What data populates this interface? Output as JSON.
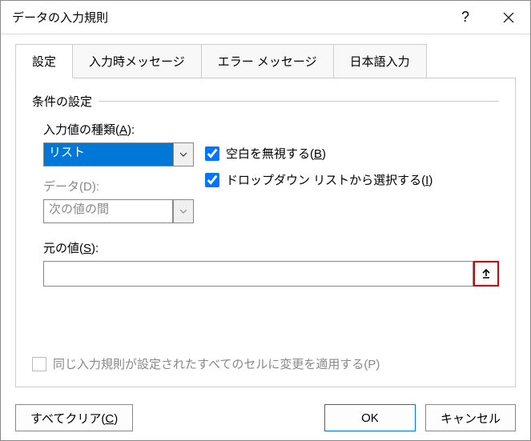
{
  "titlebar": {
    "title": "データの入力規則"
  },
  "tabs": {
    "settings": "設定",
    "input_msg": "入力時メッセージ",
    "error_msg": "エラー メッセージ",
    "ime": "日本語入力"
  },
  "fieldset": {
    "legend": "条件の設定"
  },
  "allow": {
    "label_pre": "入力値の種類(",
    "label_key": "A",
    "label_post": "):",
    "value": "リスト"
  },
  "dataop": {
    "label": "データ(D):",
    "value": "次の値の間"
  },
  "ignore_blank": {
    "label_pre": "空白を無視する(",
    "label_key": "B",
    "label_post": ")",
    "checked": true
  },
  "dropdown": {
    "label_pre": "ドロップダウン リストから選択する(",
    "label_key": "I",
    "label_post": ")",
    "checked": true
  },
  "source": {
    "label_pre": "元の値(",
    "label_key": "S",
    "label_post": "):",
    "value": ""
  },
  "apply_all": {
    "label": "同じ入力規則が設定されたすべてのセルに変更を適用する(P)"
  },
  "buttons": {
    "clear_pre": "すべてクリア(",
    "clear_key": "C",
    "clear_post": ")",
    "ok": "OK",
    "cancel": "キャンセル"
  }
}
